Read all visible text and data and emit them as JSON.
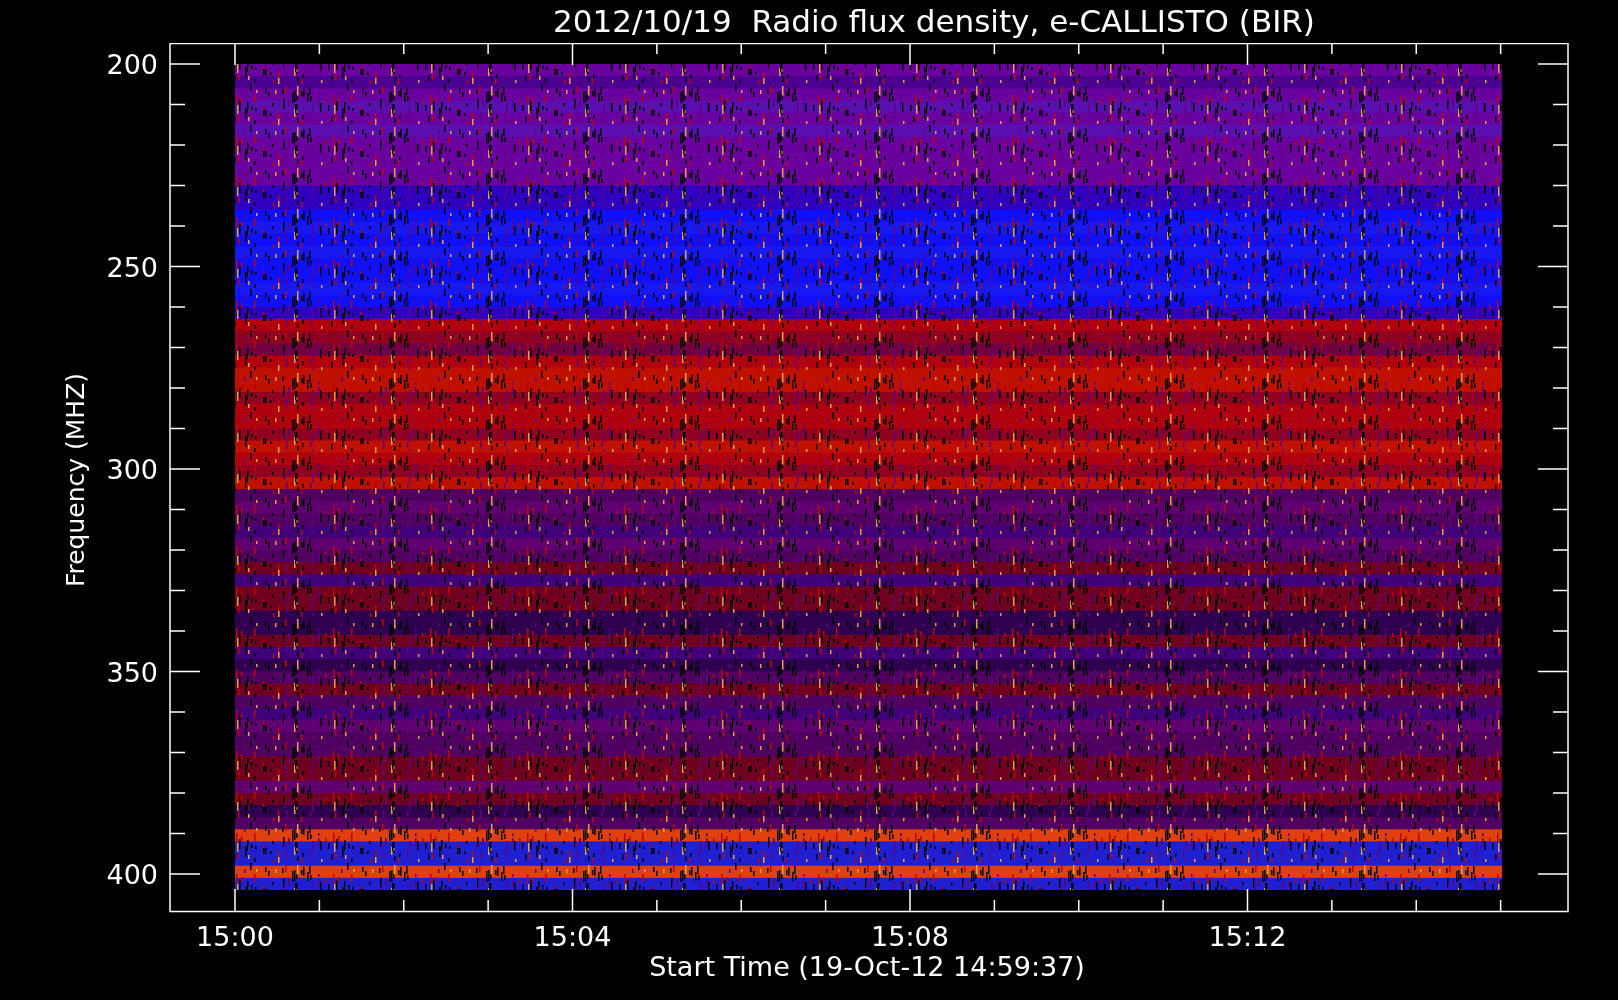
{
  "title": "2012/10/19  Radio flux density, e-CALLISTO (BIR)",
  "y_axis": {
    "label": "Frequency (MHZ)",
    "ticks": [
      "200",
      "250",
      "300",
      "350",
      "400"
    ]
  },
  "x_axis": {
    "label": "Start Time (19-Oct-12 14:59:37)",
    "ticks": [
      "15:00",
      "15:04",
      "15:08",
      "15:12"
    ]
  }
}
